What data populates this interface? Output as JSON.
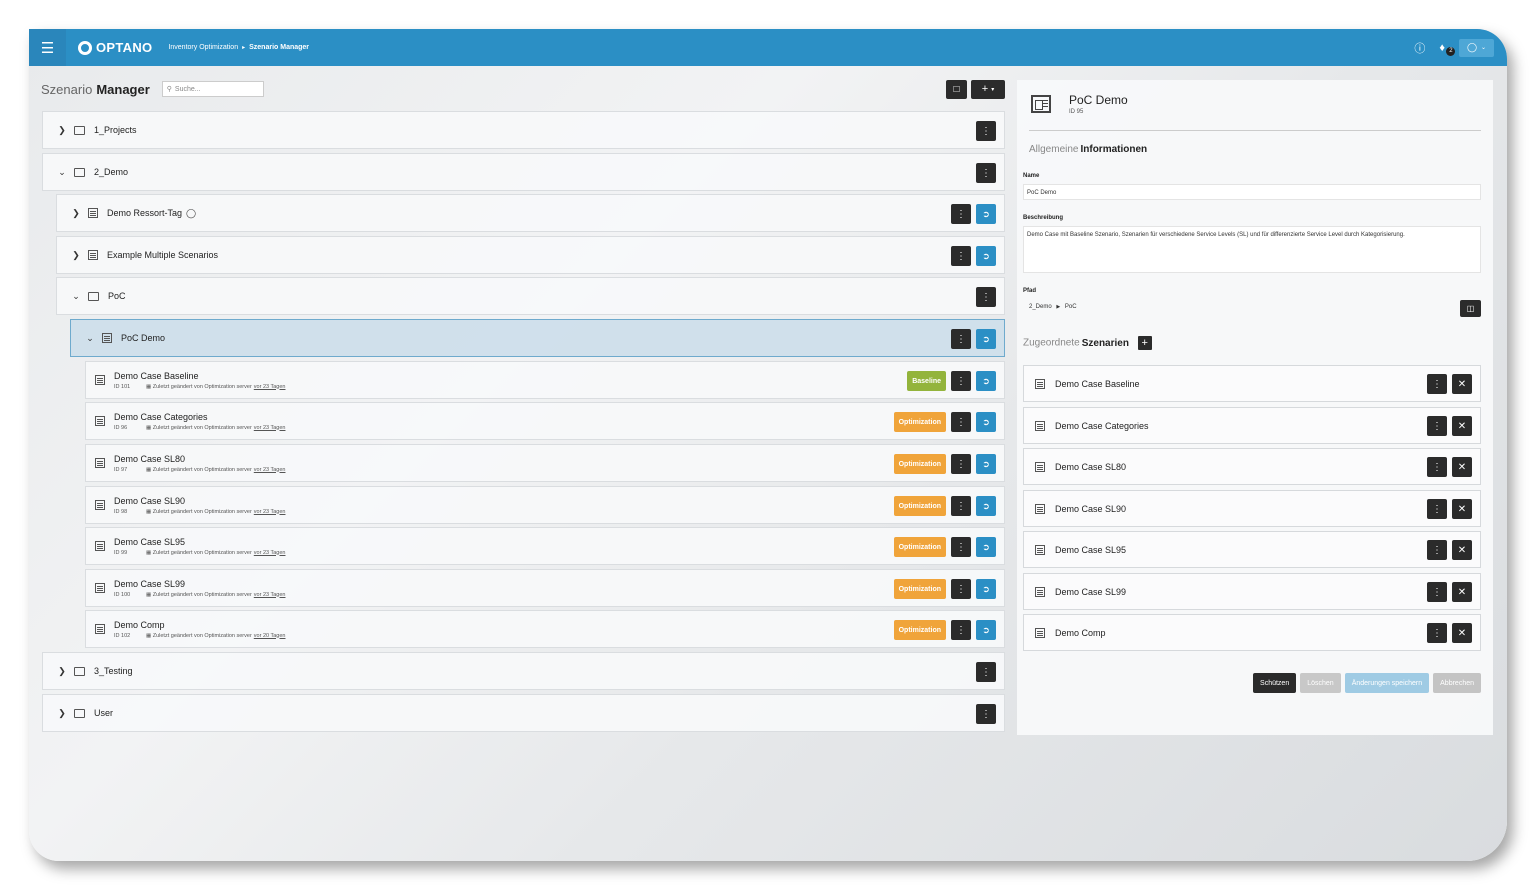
{
  "topbar": {
    "logo": "OPTANO",
    "breadcrumb": [
      "Inventory Optimization",
      "Szenario Manager"
    ],
    "notifications": "2"
  },
  "left": {
    "title_light": "Szenario",
    "title_bold": "Manager",
    "search_placeholder": "Suche..."
  },
  "tree": {
    "projects": "1_Projects",
    "demo": "2_Demo",
    "ressort": "Demo Ressort-Tag",
    "multiple": "Example Multiple Scenarios",
    "poc": "PoC",
    "pocdemo": "PoC Demo",
    "testing": "3_Testing",
    "user": "User"
  },
  "scenarios": [
    {
      "name": "Demo Case Baseline",
      "id": "ID 101",
      "meta": "Zuletzt geändert von Optimization server",
      "age": "vor 23 Tagen",
      "badge": "Baseline"
    },
    {
      "name": "Demo Case Categories",
      "id": "ID 96",
      "meta": "Zuletzt geändert von Optimization server",
      "age": "vor 23 Tagen",
      "badge": "Optimization"
    },
    {
      "name": "Demo Case SL80",
      "id": "ID 97",
      "meta": "Zuletzt geändert von Optimization server",
      "age": "vor 23 Tagen",
      "badge": "Optimization"
    },
    {
      "name": "Demo Case SL90",
      "id": "ID 98",
      "meta": "Zuletzt geändert von Optimization server",
      "age": "vor 23 Tagen",
      "badge": "Optimization"
    },
    {
      "name": "Demo Case SL95",
      "id": "ID 99",
      "meta": "Zuletzt geändert von Optimization server",
      "age": "vor 23 Tagen",
      "badge": "Optimization"
    },
    {
      "name": "Demo Case SL99",
      "id": "ID 100",
      "meta": "Zuletzt geändert von Optimization server",
      "age": "vor 23 Tagen",
      "badge": "Optimization"
    },
    {
      "name": "Demo Comp",
      "id": "ID 102",
      "meta": "Zuletzt geändert von Optimization server",
      "age": "vor 20 Tagen",
      "badge": "Optimization"
    }
  ],
  "detail": {
    "title": "PoC Demo",
    "id": "ID 95",
    "info_light": "Allgemeine",
    "info_bold": "Informationen",
    "name_label": "Name",
    "name_value": "PoC Demo",
    "desc_label": "Beschreibung",
    "desc_value": "Demo Case mit Baseline Szenario, Szenarien für verschiedene Service Levels (SL) und für differenzierte Service Level durch Kategorisierung.",
    "path_label": "Pfad",
    "path": [
      "2_Demo",
      "PoC"
    ],
    "assigned_light": "Zugeordnete",
    "assigned_bold": "Szenarien",
    "assigned": [
      "Demo Case Baseline",
      "Demo Case Categories",
      "Demo Case SL80",
      "Demo Case SL90",
      "Demo Case SL95",
      "Demo Case SL99",
      "Demo Comp"
    ],
    "buttons": {
      "protect": "Schützen",
      "delete": "Löschen",
      "save": "Änderungen speichern",
      "cancel": "Abbrechen"
    }
  }
}
